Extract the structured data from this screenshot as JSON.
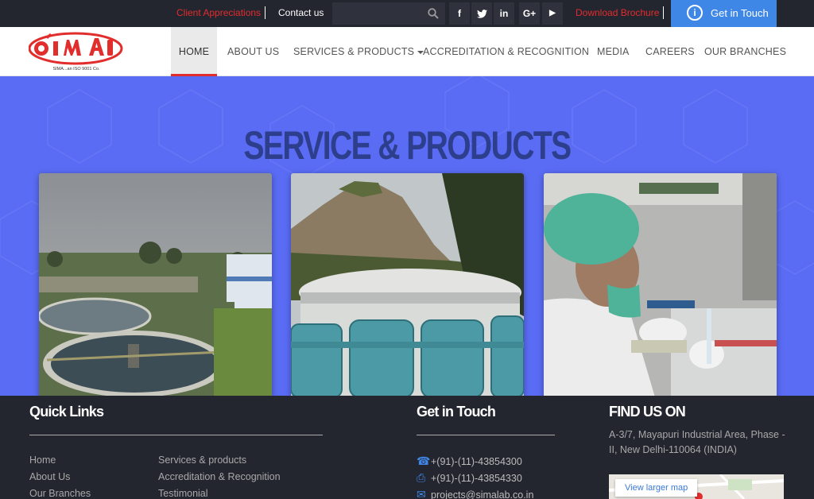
{
  "topbar": {
    "client_appreciations": "Client Appreciations",
    "contact_us": "Contact us",
    "search_placeholder": "",
    "download_brochure": "Download Brochure",
    "get_in_touch": "Get in Touch",
    "social": [
      {
        "icon": "facebook-icon",
        "glyph": "f"
      },
      {
        "icon": "twitter-icon",
        "glyph": "t"
      },
      {
        "icon": "linkedin-icon",
        "glyph": "in"
      },
      {
        "icon": "google-plus-icon",
        "glyph": "G+"
      },
      {
        "icon": "youtube-icon",
        "glyph": "▶"
      }
    ]
  },
  "brand": {
    "logo_text": "SIMA",
    "tagline": "SIMA...an ISO 9001 Co."
  },
  "nav": {
    "items": [
      "HOME",
      "ABOUT US",
      "SERVICES & PRODUCTS",
      "ACCREDITATION & RECOGNITION",
      "MEDIA",
      "CAREERS",
      "OUR BRANCHES"
    ],
    "active": "HOME"
  },
  "hero": {
    "title": "SERVICE & PRODUCTS"
  },
  "footer": {
    "quick_links_heading": "Quick Links",
    "quick_links_col1": [
      "Home",
      "About Us",
      "Our Branches"
    ],
    "quick_links_col2": [
      "Services & products",
      "Accreditation & Recognition",
      "Testimonial"
    ],
    "get_in_touch_heading": "Get in Touch",
    "phone": "+(91)-(11)-43854300",
    "fax": "+(91)-(11)-43854330",
    "email": "projects@simalab.co.in",
    "find_us_heading": "FIND US ON",
    "address": "A-3/7, Mayapuri Industrial Area, Phase - II, New Delhi-110064 (INDIA)",
    "map_button": "View larger map"
  },
  "colors": {
    "brand_red": "#e22d2d",
    "hero_blue": "#5a6cf4",
    "title_navy": "#2d3e8c",
    "dark_bg": "#23252f",
    "accent_blue": "#3f87e6"
  }
}
